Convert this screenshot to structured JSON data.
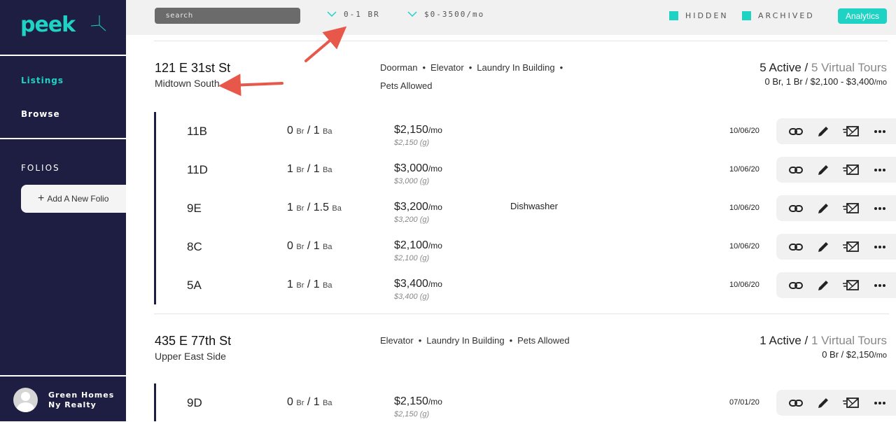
{
  "app": {
    "logo": "peek"
  },
  "sidebar": {
    "nav": [
      {
        "label": "Listings"
      },
      {
        "label": "Browse"
      }
    ],
    "folios_title": "FOLIOS",
    "add_folio_label": "Add A New Folio",
    "user_name": "Green Homes Ny Realty"
  },
  "topbar": {
    "search_placeholder": "search",
    "filter_beds": "0-1 BR",
    "filter_price": "$0-3500/mo",
    "toggle_hidden": "HIDDEN",
    "toggle_archived": "ARCHIVED",
    "analytics_label": "Analytics"
  },
  "buildings": [
    {
      "name": "121 E 31st St",
      "neighborhood": "Midtown South",
      "amenities_line1": [
        "Doorman",
        "Elevator",
        "Laundry In Building"
      ],
      "amenities_line2": "Pets Allowed",
      "active": "5 Active",
      "tours": "5 Virtual Tours",
      "range": "0 Br, 1 Br / $2,100 - $3,400",
      "range_unit": "/mo",
      "units": [
        {
          "name": "11B",
          "br": "0",
          "ba": "1",
          "price": "$2,150",
          "gross": "$2,150 (g)",
          "amenity": "",
          "date": "10/06/20"
        },
        {
          "name": "11D",
          "br": "1",
          "ba": "1",
          "price": "$3,000",
          "gross": "$3,000 (g)",
          "amenity": "",
          "date": "10/06/20"
        },
        {
          "name": "9E",
          "br": "1",
          "ba": "1.5",
          "price": "$3,200",
          "gross": "$3,200 (g)",
          "amenity": "Dishwasher",
          "date": "10/06/20"
        },
        {
          "name": "8C",
          "br": "0",
          "ba": "1",
          "price": "$2,100",
          "gross": "$2,100 (g)",
          "amenity": "",
          "date": "10/06/20"
        },
        {
          "name": "5A",
          "br": "1",
          "ba": "1",
          "price": "$3,400",
          "gross": "$3,400 (g)",
          "amenity": "",
          "date": "10/06/20"
        }
      ]
    },
    {
      "name": "435 E 77th St",
      "neighborhood": "Upper East Side",
      "amenities_line1": [
        "Elevator",
        "Laundry In Building",
        "Pets Allowed"
      ],
      "amenities_line2": "",
      "active": "1 Active",
      "tours": "1 Virtual Tours",
      "range": "0 Br / $2,150",
      "range_unit": "/mo",
      "units": [
        {
          "name": "9D",
          "br": "0",
          "ba": "1",
          "price": "$2,150",
          "gross": "$2,150 (g)",
          "amenity": "",
          "date": "07/01/20"
        }
      ]
    }
  ],
  "labels": {
    "br": "Br",
    "ba": "Ba",
    "sep": "/",
    "per_month": "/mo"
  },
  "colors": {
    "sidebar": "#1e1e42",
    "accent": "#1ed3c3",
    "annotation_arrow": "#e8584a"
  },
  "icons": [
    "link-icon",
    "edit-icon",
    "send-mail-icon",
    "more-icon",
    "chevron-down-icon",
    "plus-icon",
    "avatar-icon"
  ]
}
